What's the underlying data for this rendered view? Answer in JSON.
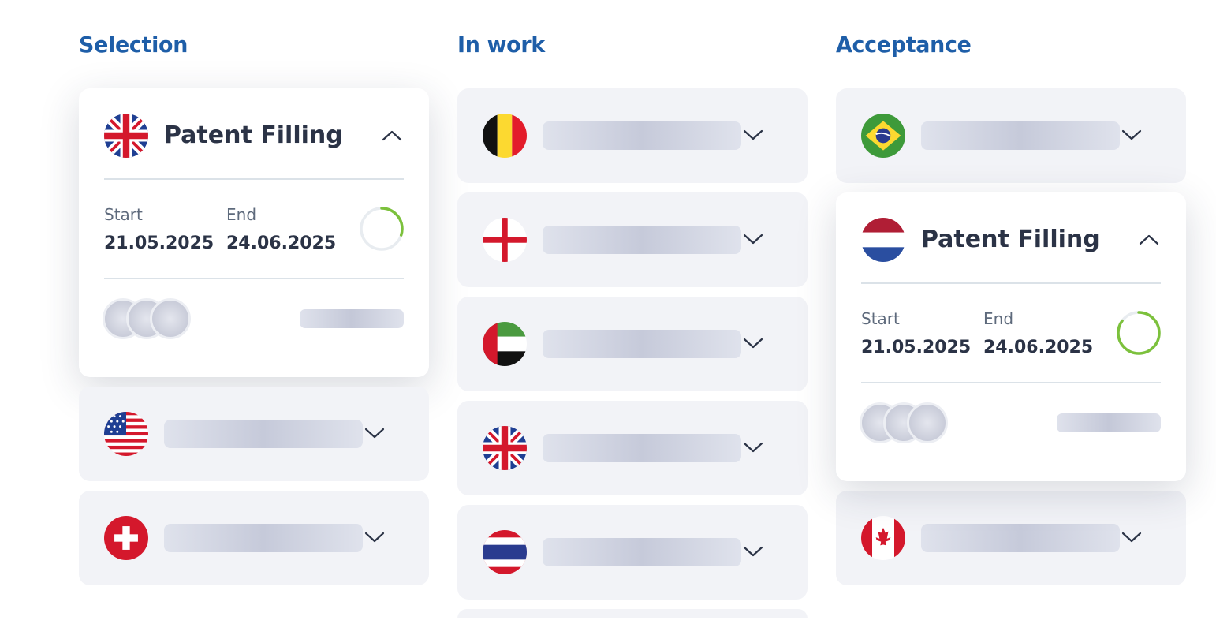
{
  "columns": [
    {
      "title": "Selection",
      "expanded": {
        "flag": "uk-flag-icon",
        "title": "Patent Filling",
        "start_label": "Start",
        "end_label": "End",
        "start_date": "21.05.2025",
        "end_date": "24.06.2025",
        "progress": 0.3
      },
      "items": [
        {
          "flag": "usa-flag-icon"
        },
        {
          "flag": "switzerland-flag-icon"
        }
      ]
    },
    {
      "title": "In work",
      "items": [
        {
          "flag": "belgium-flag-icon"
        },
        {
          "flag": "england-flag-icon"
        },
        {
          "flag": "uae-flag-icon"
        },
        {
          "flag": "uk-flag-icon"
        },
        {
          "flag": "thailand-flag-icon"
        }
      ]
    },
    {
      "title": "Acceptance",
      "items_before": [
        {
          "flag": "brazil-flag-icon"
        }
      ],
      "expanded": {
        "flag": "netherlands-flag-icon",
        "title": "Patent Filling",
        "start_label": "Start",
        "end_label": "End",
        "start_date": "21.05.2025",
        "end_date": "24.06.2025",
        "progress": 0.85
      },
      "items": [
        {
          "flag": "canada-flag-icon"
        }
      ]
    }
  ],
  "colors": {
    "heading": "#1e5ea8",
    "card_collapsed": "#f2f3f7",
    "progress": "#7cc13c",
    "progress_track": "#e8ecf0"
  }
}
